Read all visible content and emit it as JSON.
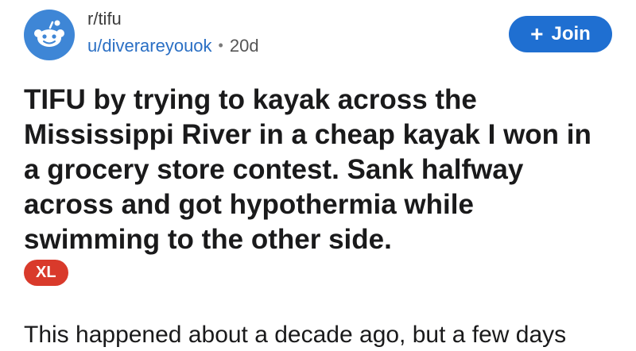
{
  "post": {
    "subreddit": "r/tifu",
    "username": "u/diverareyouok",
    "separator": "•",
    "age": "20d",
    "join_label": "Join",
    "join_icon": "+",
    "title": "TIFU by trying to kayak across the Mississippi River in a cheap kayak I won in a grocery store contest. Sank halfway across and got hypothermia while swimming to the other side.",
    "flair": "XL",
    "body_preview": "This happened about a decade ago, but a few days"
  },
  "colors": {
    "avatar_bg": "#3e86d6",
    "username": "#2a6fc4",
    "join_button": "#1f6fd1",
    "flair_bg": "#d93a2b"
  },
  "icons": {
    "avatar": "reddit-snoo-icon",
    "join": "plus-icon"
  }
}
